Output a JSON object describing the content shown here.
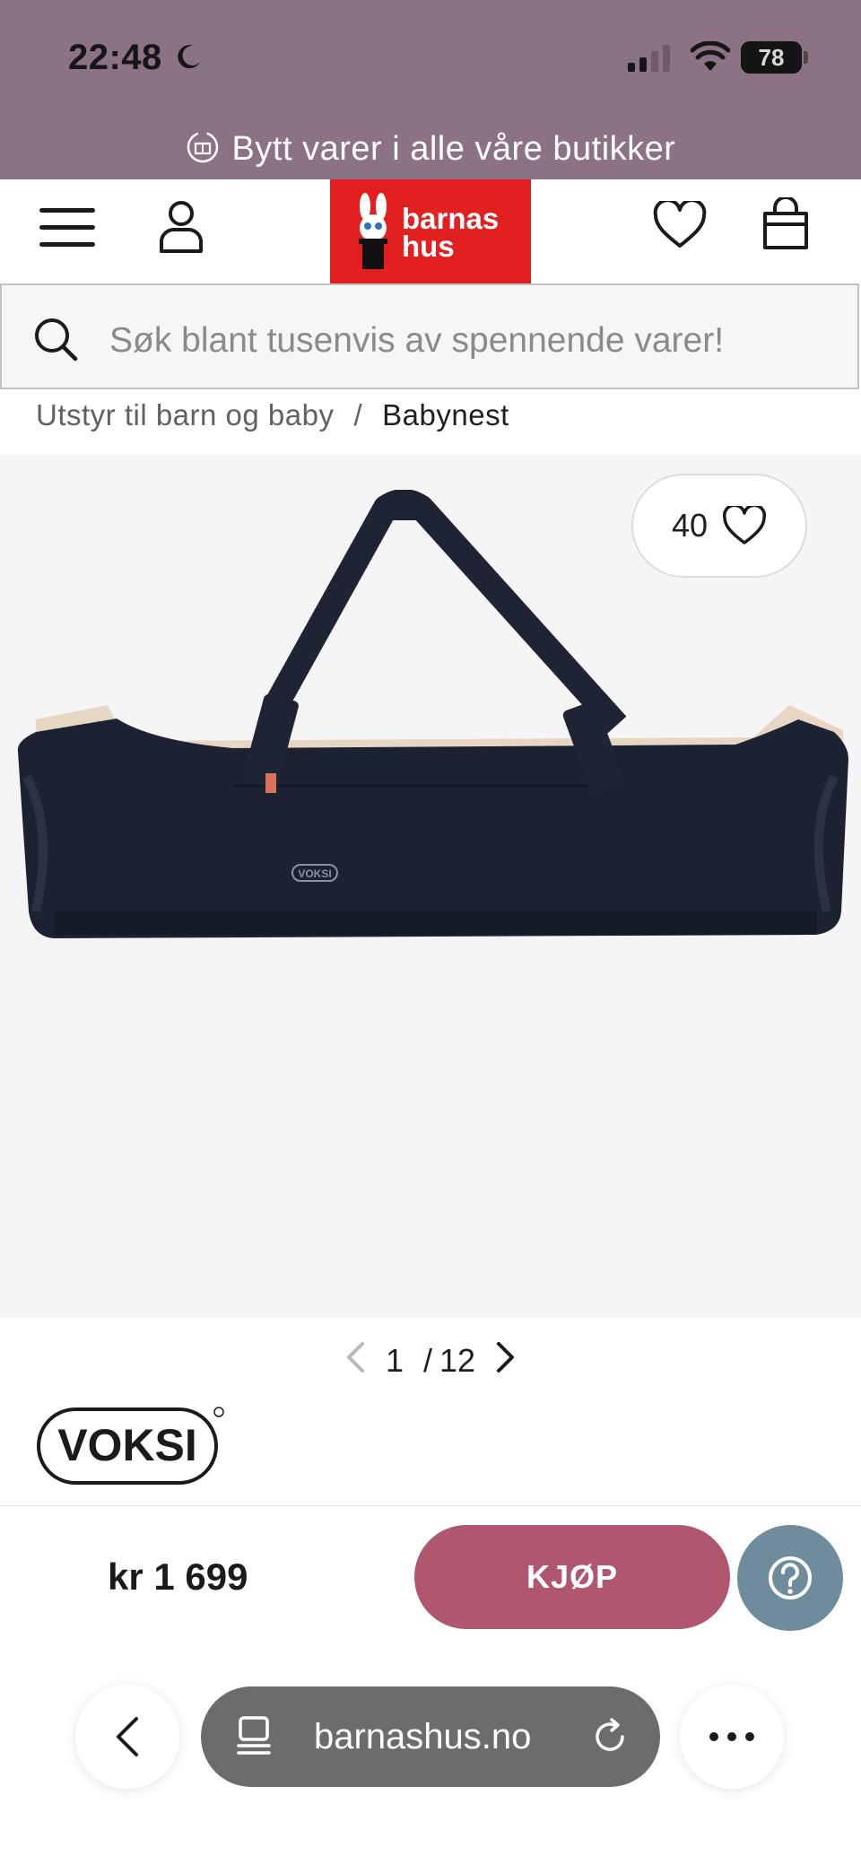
{
  "status": {
    "time": "22:48",
    "battery": "78"
  },
  "promo": {
    "text": "Bytt varer i alle våre butikker"
  },
  "header": {
    "logo_line1": "barnas",
    "logo_line2": "hus"
  },
  "search": {
    "placeholder": "Søk blant tusenvis av spennende varer!"
  },
  "breadcrumb": {
    "parent": "Utstyr til barn og baby",
    "separator": "/",
    "current": "Babynest"
  },
  "gallery": {
    "favorites_count": "40",
    "page_current": "1",
    "page_sep": "/",
    "page_total": "12"
  },
  "brand": {
    "name": "VOKSI"
  },
  "product_image": {
    "logo_text": "VOKSI"
  },
  "purchase": {
    "price": "kr 1 699",
    "buy_label": "KJØP"
  },
  "browser": {
    "url": "barnashus.no"
  },
  "colors": {
    "header_bg": "#8c7285",
    "logo_red": "#e1201f",
    "buy_button": "#b0566f",
    "help_button": "#6e8c9c",
    "url_bar": "#6c6c6c"
  },
  "icons": [
    "moon-icon",
    "signal-icon",
    "wifi-icon",
    "gift-exchange-icon",
    "menu-icon",
    "user-icon",
    "bunny-logo-icon",
    "heart-icon",
    "bag-icon",
    "search-icon",
    "chevron-left-icon",
    "chevron-right-icon",
    "help-icon",
    "tabs-icon",
    "reload-icon",
    "more-icon"
  ]
}
